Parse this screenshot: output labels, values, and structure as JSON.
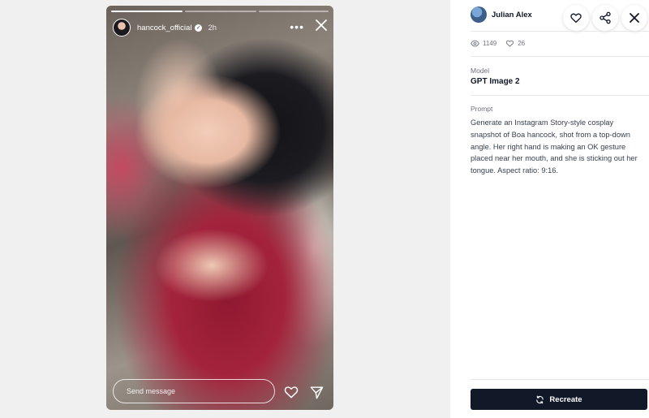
{
  "story": {
    "username": "hancock_official",
    "time_ago": "2h",
    "message_placeholder": "Send message",
    "progress_segments": 3,
    "progress_active": 1
  },
  "details": {
    "author": "Julian Alex",
    "views": "1149",
    "likes": "26",
    "model_label": "Model",
    "model_value": "GPT Image 2",
    "prompt_label": "Prompt",
    "prompt_text": "Generate an Instagram Story-style cosplay snapshot of Boa hancock, shot from a top-down angle. Her right hand is making an OK gesture placed near her mouth, and she is sticking out her tongue. Aspect ratio: 9:16.",
    "recreate_label": "Recreate"
  },
  "icons": {
    "like": "heart-icon",
    "share": "share-icon",
    "close": "close-icon",
    "views": "eye-icon",
    "likes": "heart-outline-icon",
    "recreate": "refresh-icon",
    "story_more": "more-horizontal-icon",
    "story_send": "paper-plane-icon"
  },
  "colors": {
    "primary_button": "#111827",
    "left_background": "#f0f0f0"
  }
}
